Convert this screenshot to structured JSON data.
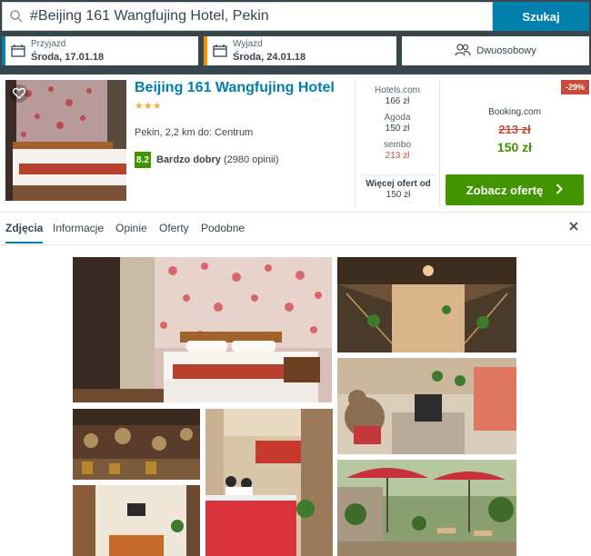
{
  "search": {
    "value": "#Beijing 161 Wangfujing Hotel, Pekin",
    "button_label": "Szukaj"
  },
  "checkin": {
    "label": "Przyjazd",
    "value": "Środa, 17.01.18",
    "accent": "#007fad"
  },
  "checkout": {
    "label": "Wyjazd",
    "value": "Środa, 24.01.18",
    "accent": "#f48f00"
  },
  "room": {
    "label": "Dwuosobowy"
  },
  "hotel": {
    "name": "Beijing 161 Wangfujing Hotel",
    "stars": "★★★",
    "location": "Pekin, 2,2 km do: Centrum",
    "rating_score": "8.2",
    "rating_label": "Bardzo dobry",
    "rating_count": "(2980 opinii)"
  },
  "prices": [
    {
      "site": "Hotels.com",
      "amount": "166 zł",
      "highlight": false
    },
    {
      "site": "Agoda",
      "amount": "150 zł",
      "highlight": false
    },
    {
      "site": "sembo",
      "amount": "213 zł",
      "highlight": true
    }
  ],
  "more_offers": {
    "title": "Więcej ofert od",
    "price": "150 zł"
  },
  "deal": {
    "discount": "-29%",
    "site": "Booking.com",
    "old_price": "213 zł",
    "new_price": "150 zł",
    "button_label": "Zobacz ofertę"
  },
  "tabs": [
    "Zdjęcia",
    "Informacje",
    "Opinie",
    "Oferty",
    "Podobne"
  ],
  "colors": {
    "brand": "#007fad",
    "header": "#37454d",
    "green": "#429400",
    "red": "#c94a38",
    "star": "#f6ab3f"
  }
}
